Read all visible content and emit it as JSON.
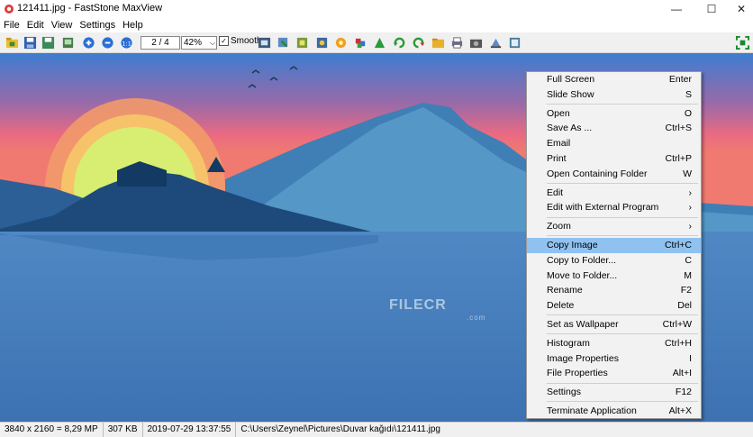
{
  "window": {
    "title": "121411.jpg - FastStone MaxView",
    "minimize_glyph": "—",
    "maximize_glyph": "☐",
    "close_glyph": "✕"
  },
  "menu": [
    "File",
    "Edit",
    "View",
    "Settings",
    "Help"
  ],
  "toolbar": {
    "page": "2 / 4",
    "zoom": "42%",
    "smooth_label": "Smooth",
    "smooth_checked": true,
    "icons": [
      "open-icon",
      "save-icon",
      "save-as-icon",
      "rotate-icon",
      "zoom-in-icon",
      "zoom-out-icon",
      "actual-size-icon",
      "resize-icon",
      "copy-to-icon",
      "move-to-icon",
      "effects-icon",
      "paint-icon",
      "color-icon",
      "histogram-icon",
      "previous-icon",
      "next-icon",
      "folder-icon",
      "print-icon",
      "image-properties-icon",
      "wallpaper-icon",
      "slideshow-icon",
      "fullscreen-icon"
    ]
  },
  "image": {
    "watermark": "FILECR",
    "watermark_suffix": ".com",
    "colors": {
      "sky_top": "#3f7fd0",
      "sky_mid": "#e56a8a",
      "sun": "#d9ee6f",
      "water": "#3f7ab8"
    }
  },
  "context_menu": {
    "groups": [
      [
        {
          "label": "Full Screen",
          "shortcut": "Enter"
        },
        {
          "label": "Slide Show",
          "shortcut": "S"
        }
      ],
      [
        {
          "label": "Open",
          "shortcut": "O"
        },
        {
          "label": "Save As ...",
          "shortcut": "Ctrl+S"
        },
        {
          "label": "Email",
          "shortcut": ""
        },
        {
          "label": "Print",
          "shortcut": "Ctrl+P"
        },
        {
          "label": "Open Containing Folder",
          "shortcut": "W"
        }
      ],
      [
        {
          "label": "Edit",
          "shortcut": "›"
        },
        {
          "label": "Edit with External Program",
          "shortcut": "›"
        }
      ],
      [
        {
          "label": "Zoom",
          "shortcut": "›"
        }
      ],
      [
        {
          "label": "Copy Image",
          "shortcut": "Ctrl+C",
          "selected": true
        },
        {
          "label": "Copy to Folder...",
          "shortcut": "C"
        },
        {
          "label": "Move to Folder...",
          "shortcut": "M"
        },
        {
          "label": "Rename",
          "shortcut": "F2"
        },
        {
          "label": "Delete",
          "shortcut": "Del"
        }
      ],
      [
        {
          "label": "Set as Wallpaper",
          "shortcut": "Ctrl+W"
        }
      ],
      [
        {
          "label": "Histogram",
          "shortcut": "Ctrl+H"
        },
        {
          "label": "Image Properties",
          "shortcut": "I"
        },
        {
          "label": "File Properties",
          "shortcut": "Alt+I"
        }
      ],
      [
        {
          "label": "Settings",
          "shortcut": "F12"
        }
      ],
      [
        {
          "label": "Terminate Application",
          "shortcut": "Alt+X"
        }
      ]
    ]
  },
  "status": {
    "dimensions": "3840 x 2160 = 8,29 MP",
    "size": "307 KB",
    "date": "2019-07-29 13:37:55",
    "path": "C:\\Users\\Zeynel\\Pictures\\Duvar kağıdı\\121411.jpg"
  }
}
